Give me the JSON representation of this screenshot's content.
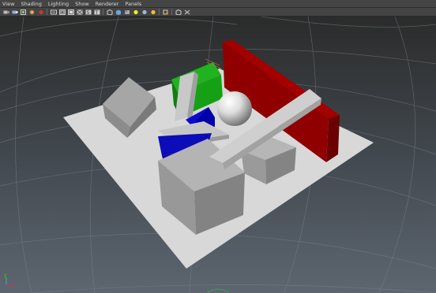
{
  "menubar": {
    "items": [
      "View",
      "Shading",
      "Lighting",
      "Show",
      "Renderer",
      "Panels"
    ]
  },
  "toolbar": {
    "buttons": [
      {
        "name": "select-camera-icon"
      },
      {
        "name": "camera-attributes-icon"
      },
      {
        "name": "bookmarks-icon"
      },
      {
        "name": "image-plane-icon"
      },
      {
        "name": "grid-toggle-icon"
      },
      {
        "name": "film-gate-icon"
      },
      {
        "name": "resolution-gate-icon"
      },
      {
        "name": "gate-mask-icon"
      },
      {
        "name": "field-chart-icon"
      },
      {
        "name": "safe-action-icon"
      },
      {
        "name": "wireframe-icon"
      },
      {
        "name": "smooth-shade-icon"
      },
      {
        "name": "textured-icon"
      },
      {
        "name": "use-default-light-icon"
      },
      {
        "name": "shadows-icon"
      },
      {
        "name": "ambient-occlusion-icon"
      },
      {
        "name": "xray-icon"
      },
      {
        "name": "isolate-select-icon"
      },
      {
        "name": "xray-joints-icon"
      }
    ]
  },
  "viewport": {
    "background_top": "#2b2b2b",
    "background_bottom": "#5d6670",
    "grid_color": "#7d8690",
    "colors": {
      "red_wall": "#b80000",
      "green_block": "#16a016",
      "blue_block": "#0b0bcc",
      "gray_object": "#b0b0b0",
      "ground": "#d8d8d8"
    },
    "axis": {
      "x_label": "x",
      "y_label": "y"
    }
  }
}
